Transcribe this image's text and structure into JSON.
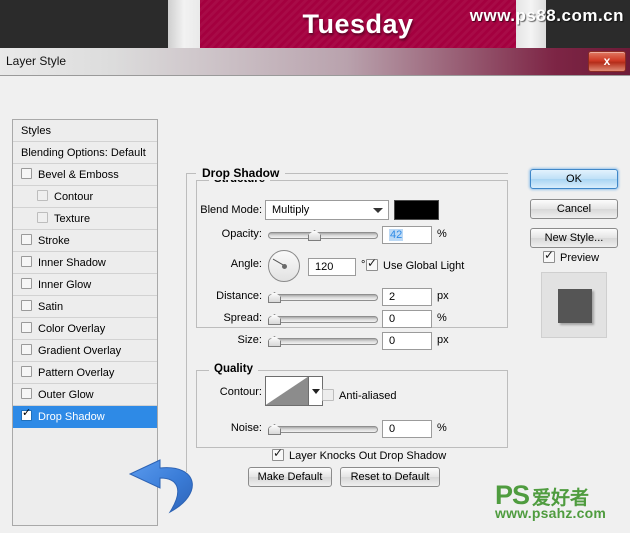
{
  "banner": {
    "title": "Tuesday",
    "watermark": "www.ps88.com.cn"
  },
  "dialog": {
    "title": "Layer Style",
    "close_label": "x"
  },
  "styles_panel": {
    "rows": [
      {
        "label": "Styles",
        "checkbox": "none",
        "checked": false,
        "sub": false,
        "selected": false
      },
      {
        "label": "Blending Options: Default",
        "checkbox": "none",
        "checked": false,
        "sub": false,
        "selected": false
      },
      {
        "label": "Bevel & Emboss",
        "checkbox": "normal",
        "checked": false,
        "sub": false,
        "selected": false
      },
      {
        "label": "Contour",
        "checkbox": "dim",
        "checked": false,
        "sub": true,
        "selected": false
      },
      {
        "label": "Texture",
        "checkbox": "dim",
        "checked": false,
        "sub": true,
        "selected": false
      },
      {
        "label": "Stroke",
        "checkbox": "normal",
        "checked": false,
        "sub": false,
        "selected": false
      },
      {
        "label": "Inner Shadow",
        "checkbox": "normal",
        "checked": false,
        "sub": false,
        "selected": false
      },
      {
        "label": "Inner Glow",
        "checkbox": "normal",
        "checked": false,
        "sub": false,
        "selected": false
      },
      {
        "label": "Satin",
        "checkbox": "normal",
        "checked": false,
        "sub": false,
        "selected": false
      },
      {
        "label": "Color Overlay",
        "checkbox": "normal",
        "checked": false,
        "sub": false,
        "selected": false
      },
      {
        "label": "Gradient Overlay",
        "checkbox": "normal",
        "checked": false,
        "sub": false,
        "selected": false
      },
      {
        "label": "Pattern Overlay",
        "checkbox": "normal",
        "checked": false,
        "sub": false,
        "selected": false
      },
      {
        "label": "Outer Glow",
        "checkbox": "normal",
        "checked": false,
        "sub": false,
        "selected": false
      },
      {
        "label": "Drop Shadow",
        "checkbox": "normal",
        "checked": true,
        "sub": false,
        "selected": true
      }
    ]
  },
  "main": {
    "section_title": "Drop Shadow",
    "structure": {
      "legend": "Structure",
      "blend_mode_label": "Blend Mode:",
      "blend_mode_value": "Multiply",
      "blend_color": "#000000",
      "opacity_label": "Opacity:",
      "opacity_value": "42",
      "opacity_unit": "%",
      "angle_label": "Angle:",
      "angle_value": "120",
      "angle_unit": "°",
      "use_global_light_label": "Use Global Light",
      "use_global_light_checked": true,
      "distance_label": "Distance:",
      "distance_value": "2",
      "distance_unit": "px",
      "spread_label": "Spread:",
      "spread_value": "0",
      "spread_unit": "%",
      "size_label": "Size:",
      "size_value": "0",
      "size_unit": "px"
    },
    "quality": {
      "legend": "Quality",
      "contour_label": "Contour:",
      "anti_aliased_label": "Anti-aliased",
      "anti_aliased_checked": false,
      "noise_label": "Noise:",
      "noise_value": "0",
      "noise_unit": "%"
    },
    "knocks_out_label": "Layer Knocks Out Drop Shadow",
    "knocks_out_checked": true,
    "make_default_label": "Make Default",
    "reset_default_label": "Reset to Default"
  },
  "actions": {
    "ok_label": "OK",
    "cancel_label": "Cancel",
    "new_style_label": "New Style...",
    "preview_label": "Preview",
    "preview_checked": true
  },
  "watermark": {
    "brand": "PS",
    "brand_cn": "爱好者",
    "url": "www.psahz.com"
  },
  "colors": {
    "accent_blue": "#2e8ae6",
    "banner_crimson": "#a4003f",
    "arrow_blue": "#3b7dd8",
    "watermark_green": "#4f9c3f"
  }
}
